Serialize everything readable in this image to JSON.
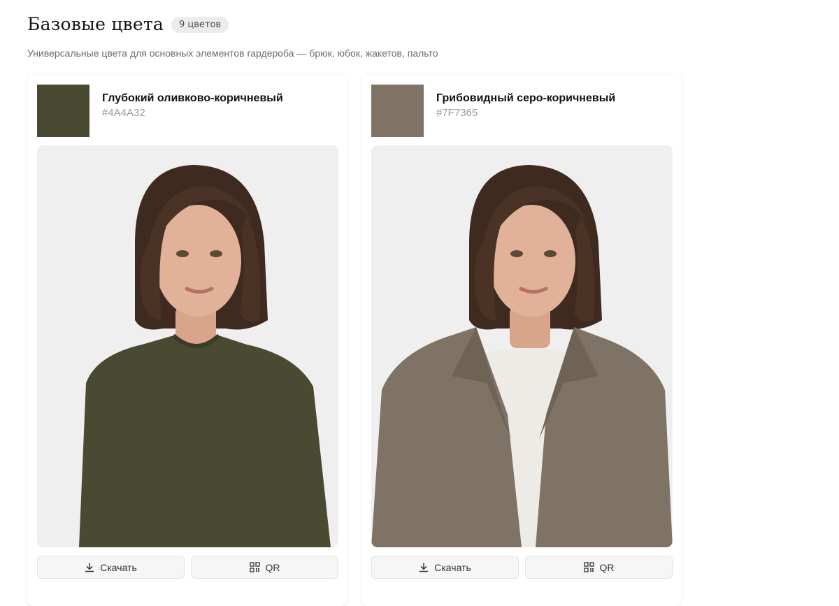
{
  "section": {
    "title": "Базовые цвета",
    "badge": "9 цветов",
    "subtitle": "Универсальные цвета для основных элементов гардероба — брюк, юбок, жакетов, пальто"
  },
  "cards": [
    {
      "name": "Глубокий оливково-коричневый",
      "hex": "#4A4A32",
      "swatch_color": "#4A4A32",
      "photo_icon": "portrait-sweater",
      "download_label": "Скачать",
      "qr_label": "QR"
    },
    {
      "name": "Грибовидный серо-коричневый",
      "hex": "#7F7365",
      "swatch_color": "#7F7365",
      "photo_icon": "portrait-blazer",
      "download_label": "Скачать",
      "qr_label": "QR"
    }
  ],
  "icons": {
    "download": "download-icon",
    "qr": "qr-code-icon"
  }
}
